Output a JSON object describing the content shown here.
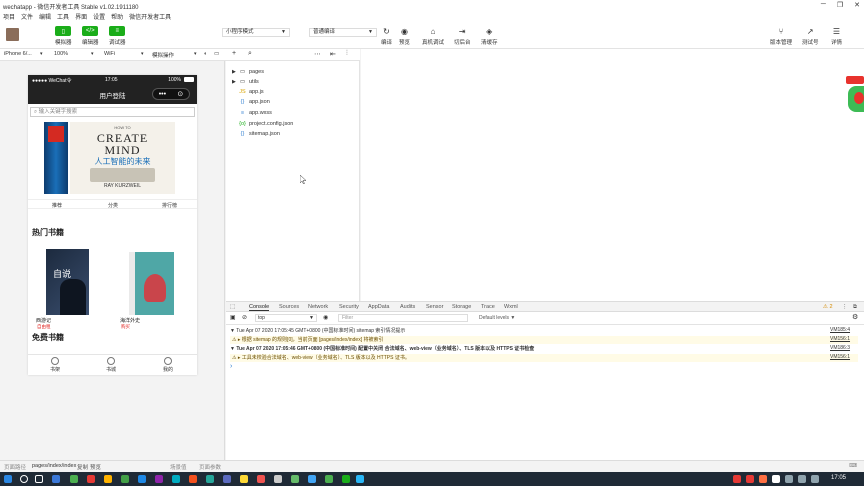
{
  "window": {
    "title": "wechatapp - 微信开发者工具 Stable v1.02.1911180",
    "controls": [
      "─",
      "❐",
      "✕"
    ]
  },
  "menu": [
    "项目",
    "文件",
    "编辑",
    "工具",
    "界面",
    "设置",
    "帮助",
    "微信开发者工具"
  ],
  "toolbar": {
    "left_buttons": [
      {
        "label": "模拟器",
        "icon": "▯"
      },
      {
        "label": "编辑器",
        "icon": "</>"
      },
      {
        "label": "调试器",
        "icon": "≡"
      }
    ],
    "mode_select": "小程序模式",
    "compile_select": "普通编译",
    "actions": [
      {
        "label": "编译",
        "icon": "↻"
      },
      {
        "label": "预览",
        "icon": "◉"
      },
      {
        "label": "真机调试",
        "icon": "⌂"
      },
      {
        "label": "切后台",
        "icon": "⇥"
      },
      {
        "label": "清缓存",
        "icon": "◈"
      }
    ],
    "right_actions": [
      {
        "label": "版本管理",
        "icon": "⑂"
      },
      {
        "label": "测试号",
        "icon": "↗"
      },
      {
        "label": "详情",
        "icon": "☰"
      }
    ]
  },
  "simbar": {
    "device": "iPhone 6/...",
    "zoom": "100%",
    "network": "WiFi",
    "operation": "模拟操作"
  },
  "phone": {
    "status_left": "●●●●● WeChat令",
    "status_time": "17:05",
    "status_right": "100%",
    "nav_title": "用户登陆",
    "capsule_dots": "•••",
    "capsule_close": "⊙",
    "search_placeholder": "输入关键字搜索",
    "banner": {
      "top": "HOW TO",
      "line1": "CREATE",
      "line2": "MIND",
      "cn": "人工智能的未来",
      "author": "RAY KURZWEIL"
    },
    "quick_tabs": [
      "推荐",
      "分类",
      "排行榜"
    ],
    "hot_title": "热门书籍",
    "books": [
      {
        "title": "西游记",
        "price": "自由租",
        "cover_text": "自说"
      },
      {
        "title": "海洋外史",
        "price": "购买"
      }
    ],
    "free_title": "免费书籍",
    "tabbar": [
      "书架",
      "书城",
      "我的"
    ]
  },
  "explorer": {
    "items": [
      {
        "name": "pages",
        "kind": "folder"
      },
      {
        "name": "utils",
        "kind": "folder"
      },
      {
        "name": "app.js",
        "kind": "js"
      },
      {
        "name": "app.json",
        "kind": "json"
      },
      {
        "name": "app.wxss",
        "kind": "wxss"
      },
      {
        "name": "project.config.json",
        "kind": "config"
      },
      {
        "name": "sitemap.json",
        "kind": "json"
      }
    ]
  },
  "devtools": {
    "tabs": [
      "Console",
      "Sources",
      "Network",
      "Security",
      "AppData",
      "Audits",
      "Sensor",
      "Storage",
      "Trace",
      "Wxml"
    ],
    "warn_count": "⚠ 2",
    "context": "top",
    "filter_placeholder": "Filter",
    "levels": "Default levels ▼",
    "lines": [
      {
        "text": "▼ Tue Apr 07 2020 17:05:45 GMT+0800 (中国标准时间) sitemap 索引情况提示",
        "link": "VM185:4",
        "warn": false
      },
      {
        "text": "⚠ ▸ 根据 sitemap 的规则[0]，当前页面 [pages/index/index] 将被索引",
        "link": "VM156:1",
        "warn": true
      },
      {
        "text": "▼ Tue Apr 07 2020 17:05:46 GMT+0800 (中国标准时间) 配置中关闭 合法域名、web-view（业务域名）、TLS 版本以及 HTTPS 证书检查",
        "link": "VM186:3",
        "warn": false
      },
      {
        "text": "⚠ ▸ 工具未校验合法域名、web-view（业务域名）、TLS 版本以及 HTTPS 证书。",
        "link": "VM156:1",
        "warn": true
      }
    ],
    "prompt": "›"
  },
  "statusbar": {
    "left_label": "页面路径",
    "path": "pages/index/index",
    "copy": "复制",
    "preview": "预览",
    "scene": "场景值",
    "params": "页面参数"
  },
  "taskbar": {
    "time": "17:05"
  },
  "colors": {
    "accent": "#1aad19",
    "dark": "#222222",
    "warn_bg": "#fffbe6",
    "taskbar": "#1f2a36"
  }
}
